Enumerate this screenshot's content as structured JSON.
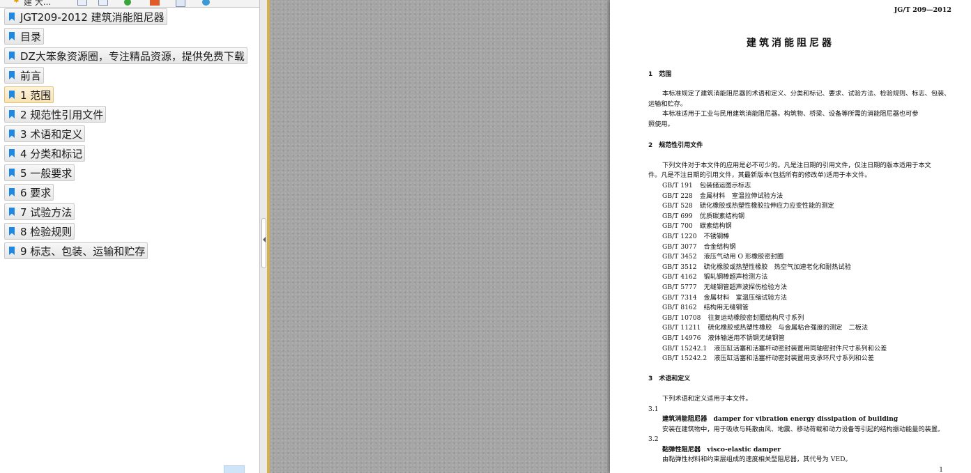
{
  "toolbar": {
    "label": "建 大...",
    "collapse_glyph": "≚"
  },
  "bookmarks": [
    {
      "label": "JGT209-2012 建筑消能阻尼器",
      "active": false
    },
    {
      "label": "目录",
      "active": false
    },
    {
      "label": "DZ大笨象资源圈，专注精品资源，提供免费下载",
      "active": false
    },
    {
      "label": "前言",
      "active": false
    },
    {
      "label": "1 范围",
      "active": true
    },
    {
      "label": "2 规范性引用文件",
      "active": false
    },
    {
      "label": "3 术语和定义",
      "active": false
    },
    {
      "label": "4 分类和标记",
      "active": false
    },
    {
      "label": "5 一般要求",
      "active": false
    },
    {
      "label": "6 要求",
      "active": false
    },
    {
      "label": "7 试验方法",
      "active": false
    },
    {
      "label": "8 检验规则",
      "active": false
    },
    {
      "label": "9 标志、包装、运输和贮存",
      "active": false
    }
  ],
  "document": {
    "std_number": "JG/T 209—2012",
    "title": "建筑消能阻尼器",
    "sec1_heading": "1　范围",
    "sec1_para1_line1": "本标准规定了建筑消能阻尼器的术语和定义、分类和标记、要求、试验方法、检验规则、标志、包装、",
    "sec1_para1_line2": "运输和贮存。",
    "sec1_para2_line1": "本标准适用于工业与民用建筑消能阻尼器。构筑物、桥梁、设备等所需的消能阻尼器也可参",
    "sec1_para2_line2": "照使用。",
    "sec2_heading": "2　规范性引用文件",
    "sec2_intro_line1": "下列文件对于本文件的应用是必不可少的。凡是注日期的引用文件，仅注日期的版本适用于本文",
    "sec2_intro_line2": "件。凡是不注日期的引用文件，其最新版本(包括所有的修改单)适用于本文件。",
    "references": [
      {
        "code": "GB/T 191",
        "name": "包装储运图示标志"
      },
      {
        "code": "GB/T 228",
        "name": "金属材料　室温拉伸试验方法"
      },
      {
        "code": "GB/T 528",
        "name": "硫化橡胶或热塑性橡胶拉伸应力应变性能的测定"
      },
      {
        "code": "GB/T 699",
        "name": "优质碳素结构钢"
      },
      {
        "code": "GB/T 700",
        "name": "碳素结构钢"
      },
      {
        "code": "GB/T 1220",
        "name": "不锈钢棒"
      },
      {
        "code": "GB/T 3077",
        "name": "合金结构钢"
      },
      {
        "code": "GB/T 3452",
        "name": "液压气动用 O 形橡胶密封圈"
      },
      {
        "code": "GB/T 3512",
        "name": "硫化橡胶或热塑性橡胶　热空气加速老化和耐热试验"
      },
      {
        "code": "GB/T 4162",
        "name": "锻轧钢棒超声检测方法"
      },
      {
        "code": "GB/T 5777",
        "name": "无缝钢管超声波探伤检验方法"
      },
      {
        "code": "GB/T 7314",
        "name": "金属材料　室温压缩试验方法"
      },
      {
        "code": "GB/T 8162",
        "name": "结构用无缝钢管"
      },
      {
        "code": "GB/T 10708",
        "name": "往复运动橡胶密封圈结构尺寸系列"
      },
      {
        "code": "GB/T 11211",
        "name": "硫化橡胶或热塑性橡胶　与金属粘合强度的测定　二板法"
      },
      {
        "code": "GB/T 14976",
        "name": "液体输送用不锈钢无缝钢管"
      },
      {
        "code": "GB/T 15242.1",
        "name": "液压缸活塞和活塞杆动密封装置用同轴密封件尺寸系列和公差"
      },
      {
        "code": "GB/T 15242.2",
        "name": "液压缸活塞和活塞杆动密封装置用支承环尺寸系列和公差"
      }
    ],
    "sec3_heading": "3　术语和定义",
    "sec3_intro": "下列术语和定义适用于本文件。",
    "term1_num": "3.1",
    "term1_head": "建筑消能阻尼器　damper for vibration energy dissipation of building",
    "term1_def": "安装在建筑物中，用于吸收与耗散由风、地震、移动荷载和动力设备等引起的结构振动能量的装置。",
    "term2_num": "3.2",
    "term2_head": "黏弹性阻尼器　visco-elastic damper",
    "term2_def": "由黏弹性材料和约束层组成的速度相关型阻尼器，其代号为 VED。",
    "page_number": "1"
  }
}
